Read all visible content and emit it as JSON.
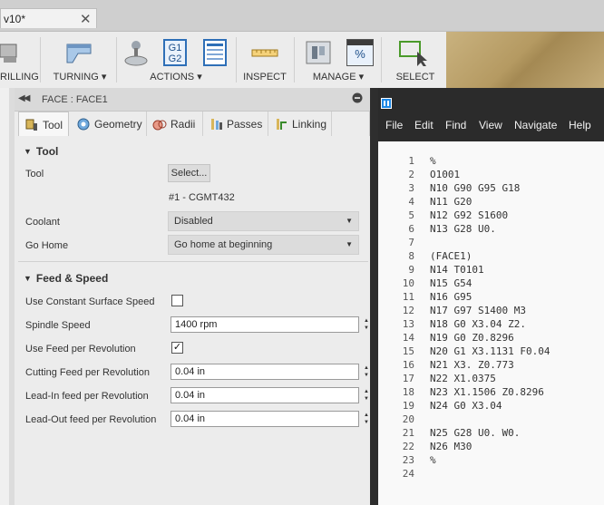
{
  "document": {
    "tab_title": "v10*",
    "close_symbol": "✕"
  },
  "toolbar": {
    "groups": [
      {
        "label": "RILLING"
      },
      {
        "label": "TURNING ▾"
      },
      {
        "label": "ACTIONS ▾",
        "icon_text": "G1\nG2"
      },
      {
        "label": "INSPECT"
      },
      {
        "label": "MANAGE ▾",
        "icon_text": "%"
      },
      {
        "label": "SELECT"
      }
    ]
  },
  "panel": {
    "title": "FACE : FACE1",
    "tabs": [
      {
        "label": "Tool",
        "active": true,
        "icon": "tool-icon"
      },
      {
        "label": "Geometry",
        "icon": "geometry-icon"
      },
      {
        "label": "Radii",
        "icon": "radii-icon"
      },
      {
        "label": "Passes",
        "icon": "passes-icon"
      },
      {
        "label": "Linking",
        "icon": "linking-icon"
      }
    ],
    "tool_section": {
      "heading": "Tool",
      "tool_label": "Tool",
      "tool_button": "Select...",
      "tool_name": "#1 - CGMT432",
      "coolant_label": "Coolant",
      "coolant_value": "Disabled",
      "gohome_label": "Go Home",
      "gohome_value": "Go home at beginning"
    },
    "feed_section": {
      "heading": "Feed & Speed",
      "css_label": "Use Constant Surface Speed",
      "css_checked": false,
      "spindle_label": "Spindle Speed",
      "spindle_value": "1400 rpm",
      "fpr_label": "Use Feed per Revolution",
      "fpr_checked": true,
      "cutting_label": "Cutting Feed per Revolution",
      "cutting_value": "0.04 in",
      "leadin_label": "Lead-In feed per Revolution",
      "leadin_value": "0.04 in",
      "leadout_label": "Lead-Out feed per Revolution",
      "leadout_value": "0.04 in"
    }
  },
  "editor": {
    "menu": [
      "File",
      "Edit",
      "Find",
      "View",
      "Navigate",
      "Help"
    ],
    "lines": [
      "%",
      "O1001",
      "N10 G90 G95 G18",
      "N11 G20",
      "N12 G92 S1600",
      "N13 G28 U0.",
      "",
      "(FACE1)",
      "N14 T0101",
      "N15 G54",
      "N16 G95",
      "N17 G97 S1400 M3",
      "N18 G0 X3.04 Z2.",
      "N19 G0 Z0.8296",
      "N20 G1 X3.1131 F0.04",
      "N21 X3. Z0.773",
      "N22 X1.0375",
      "N23 X1.1506 Z0.8296",
      "N24 G0 X3.04",
      "",
      "N25 G28 U0. W0.",
      "N26 M30",
      "%",
      ""
    ]
  }
}
